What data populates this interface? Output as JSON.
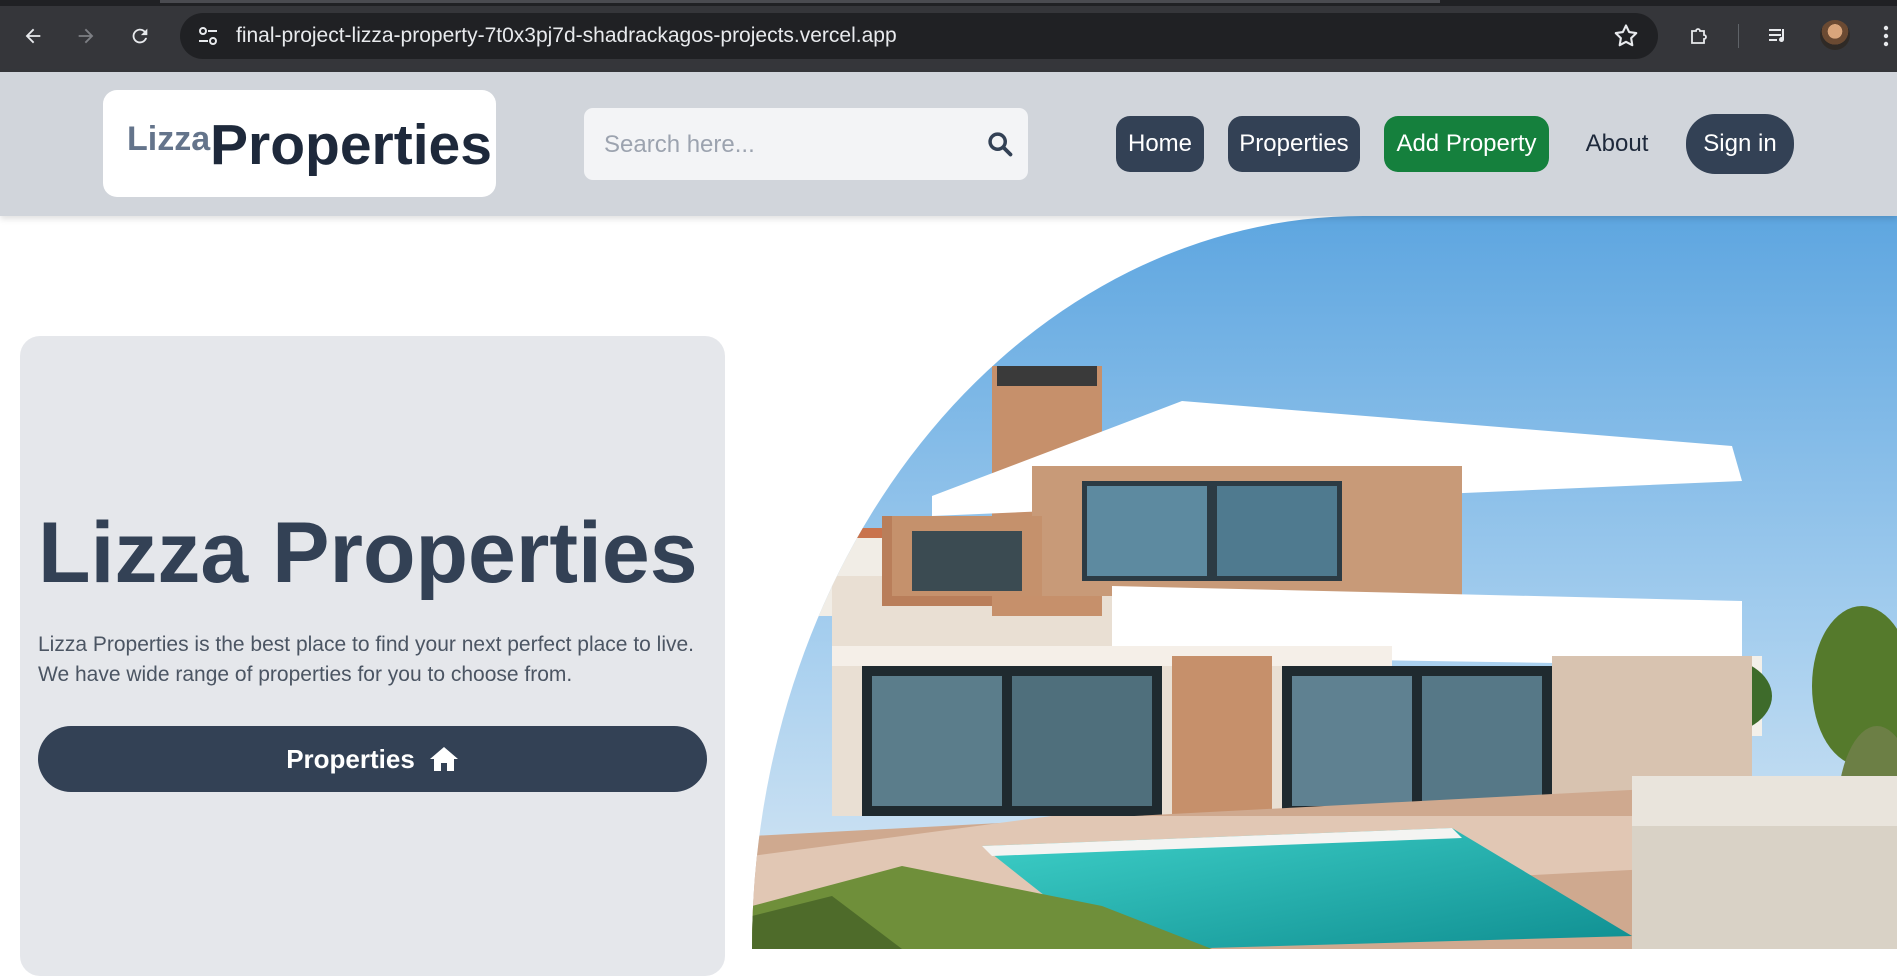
{
  "browser": {
    "url": "final-project-lizza-property-7t0x3pj7d-shadrackagos-projects.vercel.app"
  },
  "header": {
    "logo_small": "Lizza",
    "logo_large": "Properties",
    "search_placeholder": "Search here...",
    "nav": {
      "home": "Home",
      "properties": "Properties",
      "add_property": "Add Property",
      "about": "About",
      "sign_in": "Sign in"
    }
  },
  "hero": {
    "title": "Lizza Properties",
    "description_line1": "Lizza Properties is the best place to find your next perfect place to live.",
    "description_line2": "We have wide range of properties for you to choose from.",
    "button_label": "Properties"
  },
  "icons": {
    "back": "arrow-left-icon",
    "forward": "arrow-right-icon",
    "reload": "reload-icon",
    "site_info": "tune-icon",
    "bookmark": "star-icon",
    "extensions": "puzzle-icon",
    "media": "media-queue-icon",
    "menu": "kebab-menu-icon",
    "search": "search-icon",
    "home": "home-icon"
  },
  "colors": {
    "header_bg": "#d1d5db",
    "primary_dark": "#334155",
    "add_button": "#15803d",
    "card_bg": "#e5e7eb"
  }
}
